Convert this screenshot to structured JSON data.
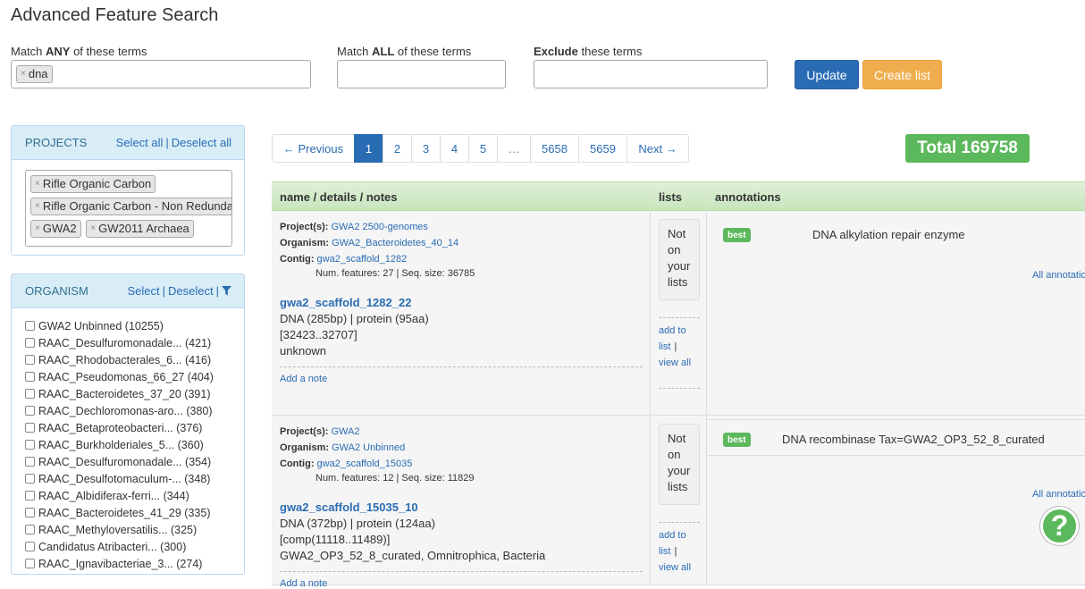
{
  "page_title": "Advanced Feature Search",
  "search": {
    "any_label_pre": "Match ",
    "any_label_bold": "ANY",
    "any_label_post": " of these terms",
    "any_tags": [
      "dna"
    ],
    "all_label_pre": "Match ",
    "all_label_bold": "ALL",
    "all_label_post": " of these terms",
    "all_value": "",
    "exclude_label_bold": "Exclude",
    "exclude_label_post": " these terms",
    "exclude_value": "",
    "update_label": "Update",
    "create_label": "Create list",
    "tag_remove": "×"
  },
  "projects": {
    "title": "PROJECTS",
    "select_all": "Select all",
    "separator": "|",
    "deselect_all": "Deselect all",
    "tags": [
      "Rifle Organic Carbon",
      "Rifle Organic Carbon - Non Redundant",
      "GWA2",
      "GW2011 Archaea"
    ]
  },
  "organism": {
    "title": "ORGANISM",
    "select": "Select",
    "separator": "|",
    "deselect": "Deselect",
    "separator2": "|",
    "filter_icon": "filter-icon",
    "items": [
      "GWA2 Unbinned (10255)",
      "RAAC_Desulfuromonadale... (421)",
      "RAAC_Rhodobacterales_6... (416)",
      "RAAC_Pseudomonas_66_27 (404)",
      "RAAC_Bacteroidetes_37_20 (391)",
      "RAAC_Dechloromonas-aro... (380)",
      "RAAC_Betaproteobacteri... (376)",
      "RAAC_Burkholderiales_5... (360)",
      "RAAC_Desulfuromonadale... (354)",
      "RAAC_Desulfotomaculum-... (348)",
      "RAAC_Albidiferax-ferri... (344)",
      "RAAC_Bacteroidetes_41_29 (335)",
      "RAAC_Methyloversatilis... (325)",
      "Candidatus Atribacteri... (300)",
      "RAAC_Ignavibacteriae_3... (274)"
    ]
  },
  "pagination": {
    "prev": "← Previous",
    "pages": [
      "1",
      "2",
      "3",
      "4",
      "5",
      "…",
      "5658",
      "5659"
    ],
    "active": "1",
    "next": "Next →"
  },
  "total": "Total 169758",
  "table": {
    "headers": {
      "name": "name / details / notes",
      "lists": "lists",
      "annotations": "annotations"
    },
    "labels": {
      "projects": "Project(s):",
      "organism": "Organism:",
      "contig": "Contig:",
      "add_note": "Add a note",
      "not_on_lists": [
        "Not",
        "on",
        "your",
        "lists"
      ],
      "add_to": "add to",
      "list": "list",
      "bar": "|",
      "view_all": "view all",
      "best": "best",
      "all_annotations": "All annotations"
    },
    "rows": [
      {
        "project": "GWA2 2500-genomes",
        "organism": "GWA2_Bacteroidetes_40_14",
        "contig": "gwa2_scaffold_1282",
        "contig_info": "Num. features: 27 | Seq. size: 36785",
        "feature": "gwa2_scaffold_1282_22",
        "seq": "DNA (285bp) | protein (95aa)",
        "coords": "[32423..32707]",
        "taxonomy": "unknown",
        "annotation": "DNA alkylation repair enzyme"
      },
      {
        "project": "GWA2",
        "organism": "GWA2 Unbinned",
        "contig": "gwa2_scaffold_15035",
        "contig_info": "Num. features: 12 | Seq. size: 11829",
        "feature": "gwa2_scaffold_15035_10",
        "seq": "DNA (372bp) | protein (124aa)",
        "coords": "[comp(11118..11489)]",
        "taxonomy": "GWA2_OP3_52_8_curated, Omnitrophica, Bacteria",
        "annotation": "DNA recombinase Tax=GWA2_OP3_52_8_curated"
      }
    ]
  },
  "help": "?"
}
